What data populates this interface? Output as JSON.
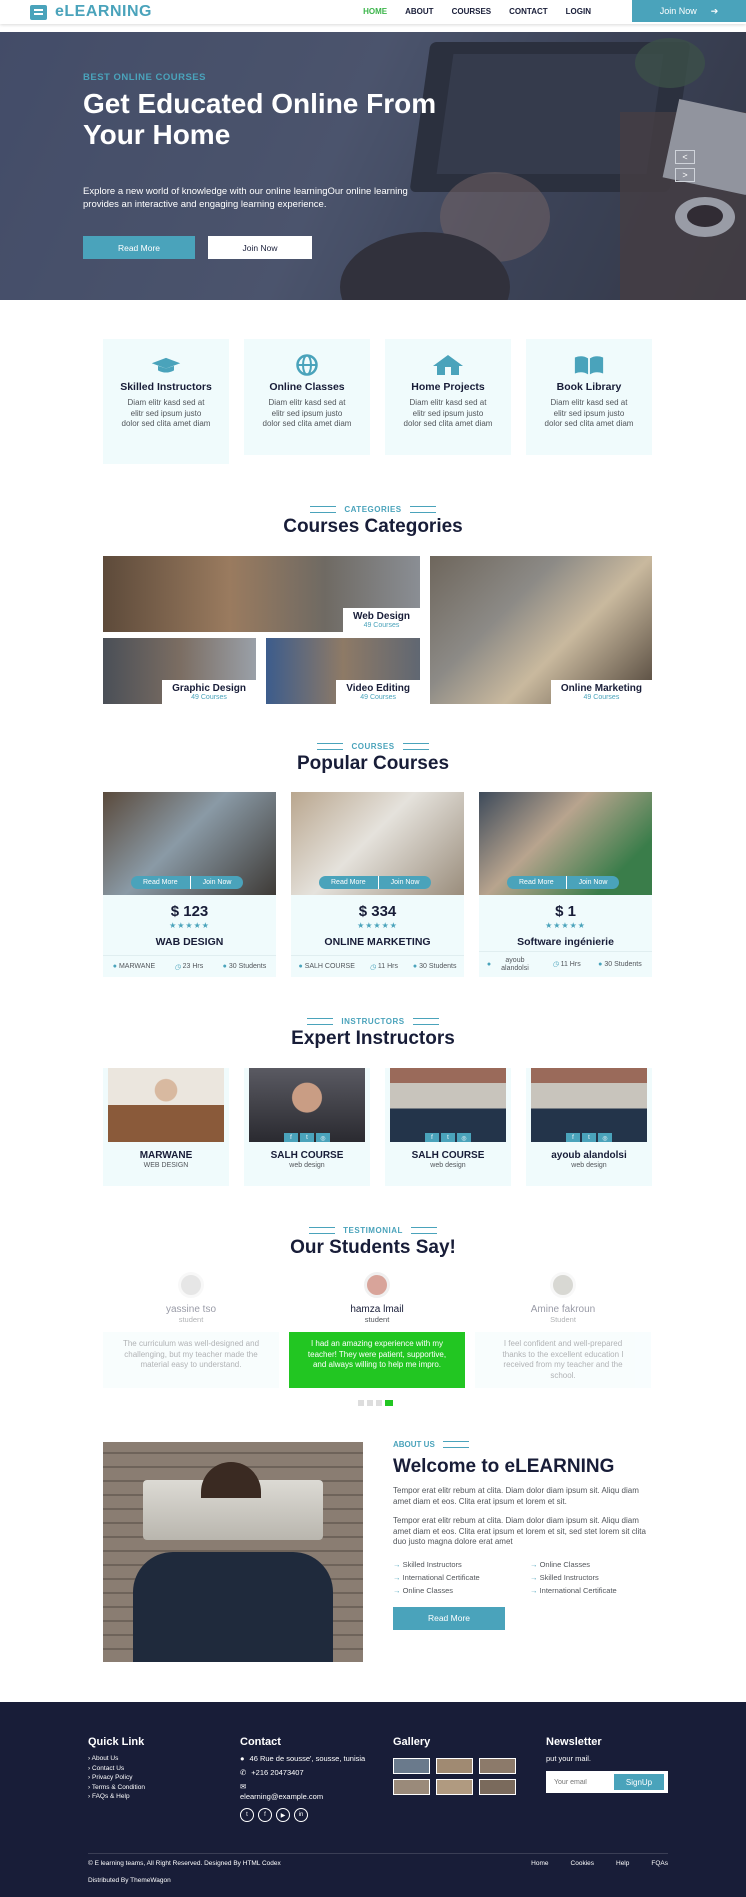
{
  "brand": {
    "name": "eLEARNING",
    "accent": "#4aa3bb",
    "green": "#3bb54a",
    "dark": "#181d38"
  },
  "nav": {
    "items": [
      "HOME",
      "ABOUT",
      "COURSES",
      "CONTACT",
      "LOGIN"
    ],
    "active": "HOME",
    "join_label": "Join Now",
    "join_icon": "arrow-right-icon"
  },
  "hero": {
    "subtitle": "BEST ONLINE COURSES",
    "title": "Get Educated Online From Your Home",
    "description": "Explore a new world of knowledge with our online learningOur online learning provides an interactive and engaging learning experience.",
    "read_more": "Read More",
    "join_now": "Join Now",
    "prev": "<",
    "next": ">"
  },
  "services": [
    {
      "icon": "graduation-cap-icon",
      "title": "Skilled Instructors",
      "text": "Diam elitr kasd sed at elitr sed ipsum justo dolor sed clita amet diam"
    },
    {
      "icon": "globe-icon",
      "title": "Online Classes",
      "text": "Diam elitr kasd sed at elitr sed ipsum justo dolor sed clita amet diam"
    },
    {
      "icon": "home-icon",
      "title": "Home Projects",
      "text": "Diam elitr kasd sed at elitr sed ipsum justo dolor sed clita amet diam"
    },
    {
      "icon": "book-open-icon",
      "title": "Book Library",
      "text": "Diam elitr kasd sed at elitr sed ipsum justo dolor sed clita amet diam"
    }
  ],
  "categories": {
    "tag": "CATEGORIES",
    "title": "Courses Categories",
    "items": [
      {
        "name": "Web Design",
        "count": "49 Courses"
      },
      {
        "name": "Graphic Design",
        "count": "49 Courses"
      },
      {
        "name": "Video Editing",
        "count": "49 Courses"
      },
      {
        "name": "Online Marketing",
        "count": "49 Courses"
      }
    ]
  },
  "courses": {
    "tag": "COURSES",
    "title": "Popular Courses",
    "read_more": "Read More",
    "join_now": "Join Now",
    "stars": "★★★★★",
    "items": [
      {
        "price": "$ 123",
        "name": "WAB DESIGN",
        "instructor": "MARWANE",
        "duration": "23 Hrs",
        "students": "30 Students"
      },
      {
        "price": "$ 334",
        "name": "ONLINE MARKETING",
        "instructor": "SALH COURSE",
        "duration": "11 Hrs",
        "students": "30 Students"
      },
      {
        "price": "$ 1",
        "name": "Software ingénierie",
        "instructor": "ayoub alandolsi",
        "duration": "11 Hrs",
        "students": "30 Students"
      }
    ]
  },
  "instructors": {
    "tag": "INSTRUCTORS",
    "title": "Expert Instructors",
    "items": [
      {
        "name": "MARWANE",
        "role": "WEB DESIGN"
      },
      {
        "name": "SALH COURSE",
        "role": "web design"
      },
      {
        "name": "SALH COURSE",
        "role": "web design"
      },
      {
        "name": "ayoub alandolsi",
        "role": "web design"
      }
    ]
  },
  "testimonials": {
    "tag": "TESTIMONIAL",
    "title": "Our Students Say!",
    "items": [
      {
        "name": "yassine tso",
        "role": "student",
        "text": "The curriculum was well-designed and challenging, but my teacher made the material easy to understand."
      },
      {
        "name": "hamza lmail",
        "role": "student",
        "text": "I had an amazing experience with my teacher! They were patient, supportive, and always willing to help me impro."
      },
      {
        "name": "Amine fakroun",
        "role": "Student",
        "text": "I feel confident and well-prepared thanks to the excellent education I received from my teacher and the school."
      }
    ]
  },
  "about": {
    "tag": "ABOUT US",
    "title": "Welcome to eLEARNING",
    "p1": "Tempor erat elitr rebum at clita. Diam dolor diam ipsum sit. Aliqu diam amet diam et eos. Clita erat ipsum et lorem et sit.",
    "p2": "Tempor erat elitr rebum at clita. Diam dolor diam ipsum sit. Aliqu diam amet diam et eos. Clita erat ipsum et lorem et sit, sed stet lorem sit clita duo justo magna dolore erat amet",
    "checks": [
      "Skilled Instructors",
      "Online Classes",
      "International Certificate",
      "Skilled Instructors",
      "Online Classes",
      "International Certificate"
    ],
    "button": "Read More"
  },
  "footer": {
    "quick_title": "Quick Link",
    "quick_links": [
      "About Us",
      "Contact Us",
      "Privacy Policy",
      "Terms & Condition",
      "FAQs & Help"
    ],
    "contact_title": "Contact",
    "address": "46 Rue de sousse', sousse, tunisia",
    "phone": "+216 20473407",
    "email": "elearning@example.com",
    "gallery_title": "Gallery",
    "newsletter_title": "Newsletter",
    "newsletter_text": "put your mail.",
    "newsletter_placeholder": "Your email",
    "newsletter_button": "SignUp",
    "copyright": "© E learning teams, All Right Reserved. Designed By HTML Codex",
    "distributed": "Distributed By ThemeWagon",
    "bottom_links": [
      "Home",
      "Cookies",
      "Help",
      "FQAs"
    ]
  }
}
